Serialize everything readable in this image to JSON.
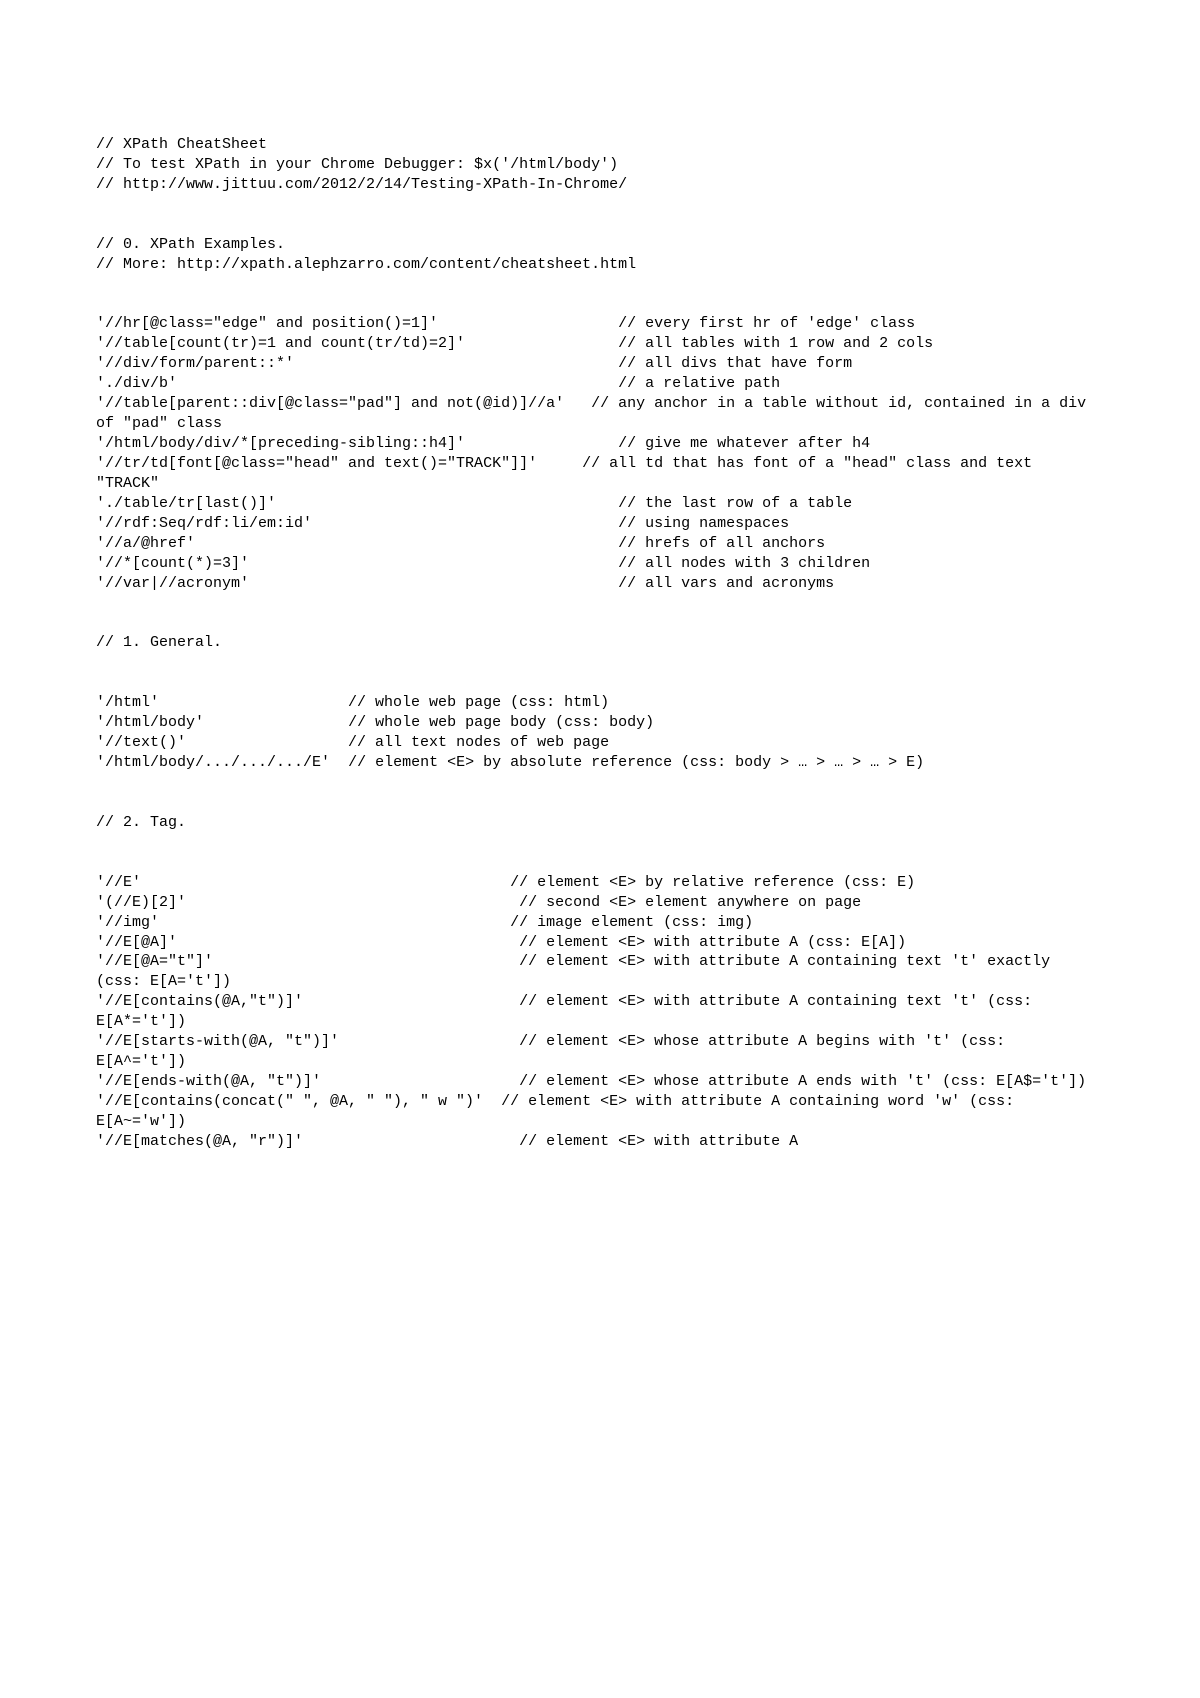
{
  "header": {
    "title": "// XPath CheatSheet",
    "debug_hint": "// To test XPath in your Chrome Debugger: $x('/html/body')",
    "source_url": "// http://www.jittuu.com/2012/2/14/Testing-XPath-In-Chrome/"
  },
  "section0": {
    "label": "// 0. XPath Examples.",
    "more": "// More: http://xpath.alephzarro.com/content/cheatsheet.html",
    "items": [
      {
        "expr": "'//hr[@class=\"edge\" and position()=1]'",
        "pad": "                    ",
        "comment": "// every first hr of 'edge' class"
      },
      {
        "expr": "'//table[count(tr)=1 and count(tr/td)=2]'",
        "pad": "                 ",
        "comment": "// all tables with 1 row and 2 cols"
      },
      {
        "expr": "'//div/form/parent::*'",
        "pad": "                                    ",
        "comment": "// all divs that have form"
      },
      {
        "expr": "'./div/b'",
        "pad": "                                                 ",
        "comment": "// a relative path"
      },
      {
        "expr": "'//table[parent::div[@class=\"pad\"] and not(@id)]//a'",
        "pad": "   ",
        "comment": "// any anchor in a table without id, contained in a div of \"pad\" class"
      },
      {
        "expr": "'/html/body/div/*[preceding-sibling::h4]'",
        "pad": "                 ",
        "comment": "// give me whatever after h4"
      },
      {
        "expr": "'//tr/td[font[@class=\"head\" and text()=\"TRACK\"]]'",
        "pad": "     ",
        "comment": "// all td that has font of a \"head\" class and text \"TRACK\""
      },
      {
        "expr": "'./table/tr[last()]'",
        "pad": "                                      ",
        "comment": "// the last row of a table"
      },
      {
        "expr": "'//rdf:Seq/rdf:li/em:id'",
        "pad": "                                  ",
        "comment": "// using namespaces"
      },
      {
        "expr": "'//a/@href'",
        "pad": "                                               ",
        "comment": "// hrefs of all anchors"
      },
      {
        "expr": "'//*[count(*)=3]'",
        "pad": "                                         ",
        "comment": "// all nodes with 3 children"
      },
      {
        "expr": "'//var|//acronym'",
        "pad": "                                         ",
        "comment": "// all vars and acronyms"
      }
    ]
  },
  "section1": {
    "label": "// 1. General.",
    "items": [
      {
        "expr": "'/html'",
        "pad": "                     ",
        "comment": "// whole web page (css: html)"
      },
      {
        "expr": "'/html/body'",
        "pad": "                ",
        "comment": "// whole web page body (css: body)"
      },
      {
        "expr": "'//text()'",
        "pad": "                  ",
        "comment": "// all text nodes of web page"
      },
      {
        "expr": "'/html/body/.../.../.../E'",
        "pad": "  ",
        "comment": "// element <E> by absolute reference (css: body > … > … > … > E)"
      }
    ]
  },
  "section2": {
    "label": "// 2. Tag.",
    "items": [
      {
        "expr": "'//E'",
        "pad": "                                         ",
        "comment": "// element <E> by relative reference (css: E)"
      },
      {
        "expr": "'(//E)[2]'",
        "pad": "                                     ",
        "comment": "// second <E> element anywhere on page"
      },
      {
        "expr": "'//img'",
        "pad": "                                       ",
        "comment": "// image element (css: img)"
      },
      {
        "expr": "'//E[@A]'",
        "pad": "                                      ",
        "comment": "// element <E> with attribute A (css: E[A])"
      },
      {
        "expr": "'//E[@A=\"t\"]'",
        "pad": "                                  ",
        "comment": "// element <E> with attribute A containing text 't' exactly (css: E[A='t'])"
      },
      {
        "expr": "'//E[contains(@A,\"t\")]'",
        "pad": "                        ",
        "comment": "// element <E> with attribute A containing text 't' (css: E[A*='t'])"
      },
      {
        "expr": "'//E[starts-with(@A, \"t\")]'",
        "pad": "                    ",
        "comment": "// element <E> whose attribute A begins with 't' (css: E[A^='t'])"
      },
      {
        "expr": "'//E[ends-with(@A, \"t\")]'",
        "pad": "                      ",
        "comment": "// element <E> whose attribute A ends with 't' (css: E[A$='t'])"
      },
      {
        "expr": "'//E[contains(concat(\" \", @A, \" \"), \" w \")'",
        "pad": "  ",
        "comment": "// element <E> with attribute A containing word 'w' (css: E[A~='w'])"
      },
      {
        "expr": "'//E[matches(@A, \"r\")]'",
        "pad": "                        ",
        "comment": "// element <E> with attribute A"
      }
    ]
  }
}
